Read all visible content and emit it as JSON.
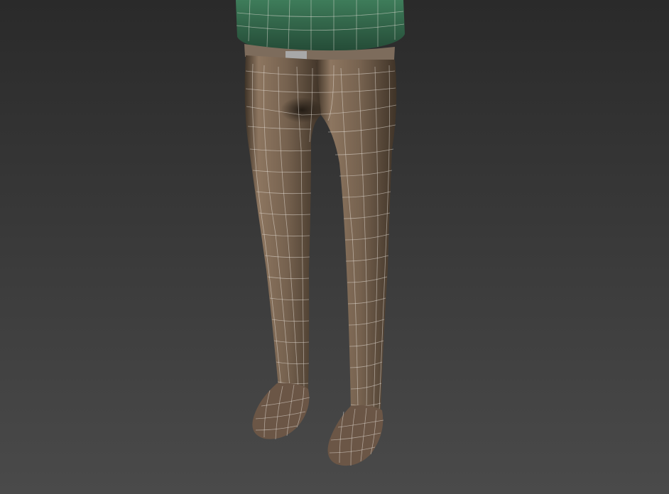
{
  "viewport": {
    "background_top": "#2a2a2a",
    "background_bottom": "#4a4a4a"
  },
  "model": {
    "shirt_color": "#3e7c5a",
    "shirt_dark": "#244a36",
    "belt_color": "#7d6c5c",
    "buckle_color": "#a8a8a8",
    "pants_color": "#76624f",
    "pants_dark": "#3f3327",
    "pants_light": "#8d7660",
    "shoe_color": "#6b5646",
    "wire_color": "#e9e4dc",
    "wire_opacity": 0.55
  }
}
